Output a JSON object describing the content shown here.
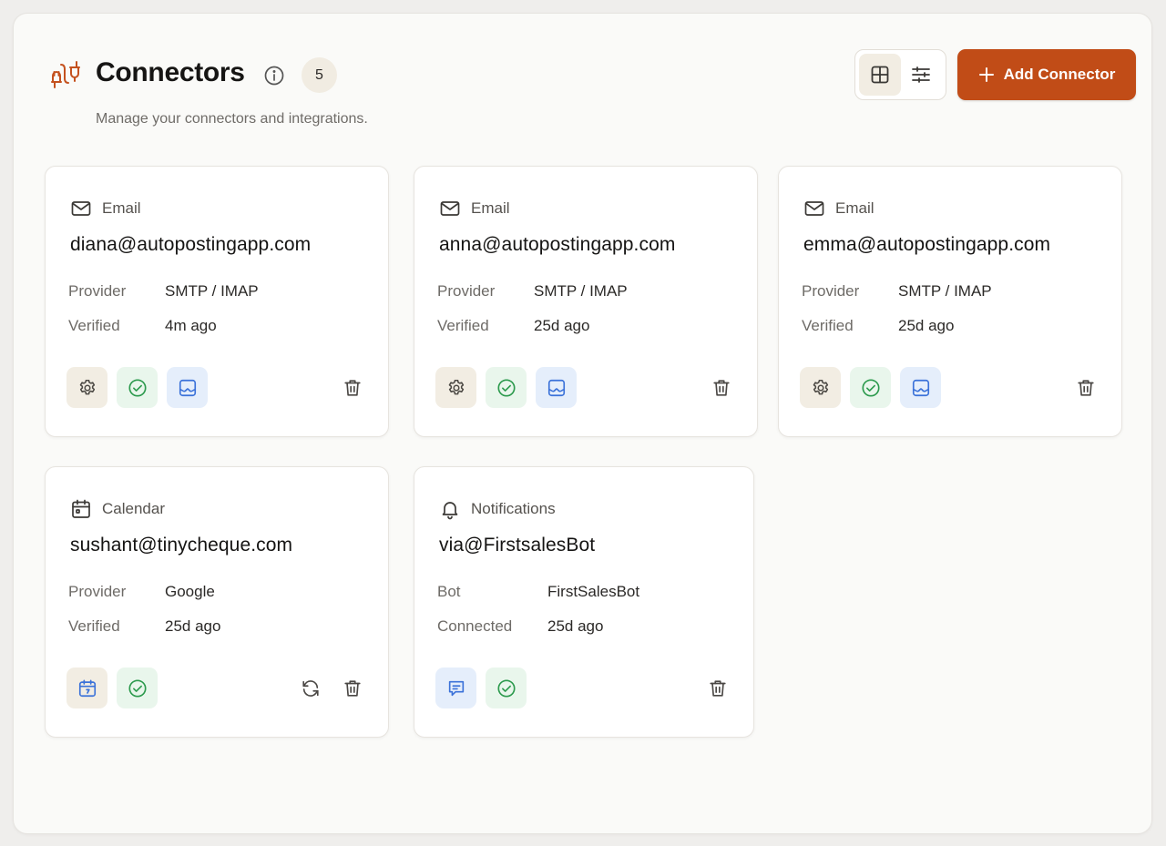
{
  "header": {
    "title": "Connectors",
    "count": "5",
    "subtitle": "Manage your connectors and integrations.",
    "add_label": "Add Connector",
    "accent": "#c14c17"
  },
  "cards": [
    {
      "type": "Email",
      "title": "diana@autopostingapp.com",
      "rows": [
        {
          "k": "Provider",
          "v": "SMTP / IMAP"
        },
        {
          "k": "Verified",
          "v": "4m ago"
        }
      ]
    },
    {
      "type": "Email",
      "title": "anna@autopostingapp.com",
      "rows": [
        {
          "k": "Provider",
          "v": "SMTP / IMAP"
        },
        {
          "k": "Verified",
          "v": "25d ago"
        }
      ]
    },
    {
      "type": "Email",
      "title": "emma@autopostingapp.com",
      "rows": [
        {
          "k": "Provider",
          "v": "SMTP / IMAP"
        },
        {
          "k": "Verified",
          "v": "25d ago"
        }
      ]
    },
    {
      "type": "Calendar",
      "title": "sushant@tinycheque.com",
      "rows": [
        {
          "k": "Provider",
          "v": "Google"
        },
        {
          "k": "Verified",
          "v": "25d ago"
        }
      ]
    },
    {
      "type": "Notifications",
      "title": "via@FirstsalesBot",
      "rows": [
        {
          "k": "Bot",
          "v": "FirstSalesBot"
        },
        {
          "k": "Connected",
          "v": "25d ago"
        }
      ]
    }
  ]
}
